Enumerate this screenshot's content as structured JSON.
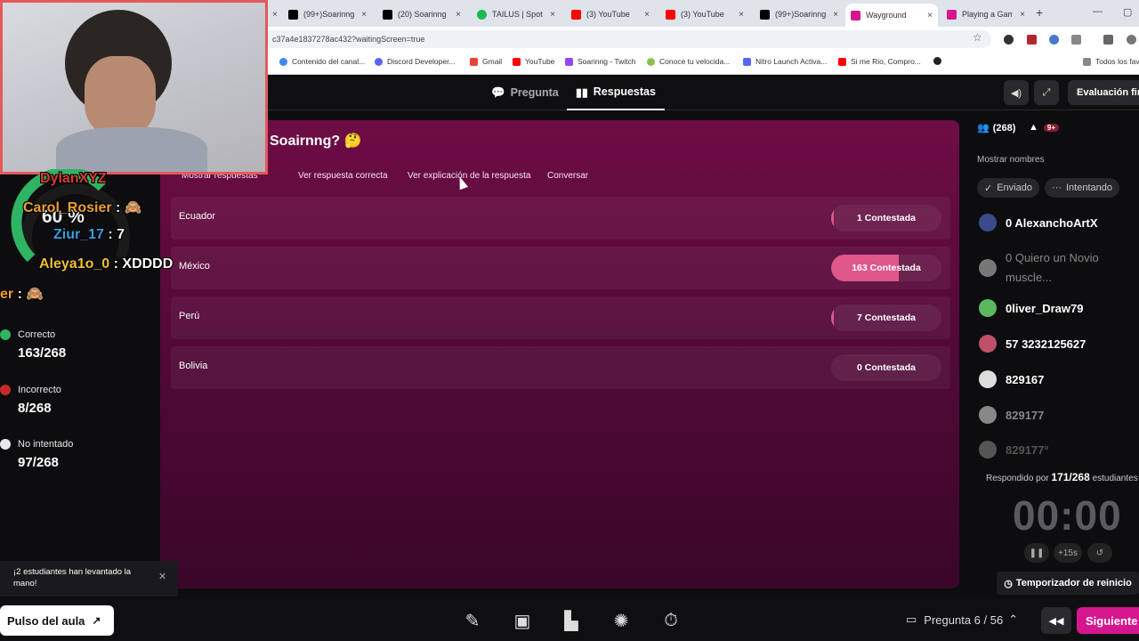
{
  "browser": {
    "tabs": [
      {
        "label": "(99+)Soarinng",
        "color": "#000000"
      },
      {
        "label": "(20) Soarinng",
        "color": "#000000"
      },
      {
        "label": "TAILUS | Spotify",
        "color": "#1db954"
      },
      {
        "label": "(3) YouTube",
        "color": "#ff0000"
      },
      {
        "label": "(3) YouTube",
        "color": "#ff0000"
      },
      {
        "label": "(99+)Soarinng",
        "color": "#000000"
      },
      {
        "label": "Wayground",
        "color": "#d6168e",
        "active": true
      },
      {
        "label": "Playing a Game",
        "color": "#d6168e"
      }
    ],
    "url": "c37a4e1837278ac432?waitingScreen=true",
    "bookmarks": [
      {
        "label": "Contenido del canal...",
        "color": "#4285f4"
      },
      {
        "label": "Discord Developer...",
        "color": "#5865f2"
      },
      {
        "label": "Gmail",
        "color": "#ea4335"
      },
      {
        "label": "YouTube",
        "color": "#ff0000"
      },
      {
        "label": "Soarinng - Twitch",
        "color": "#9146ff"
      },
      {
        "label": "Conoce tu velocida...",
        "color": "#8bc34a"
      },
      {
        "label": "Nitro Launch Activa...",
        "color": "#5865f2"
      },
      {
        "label": "Si me Rio, Compro...",
        "color": "#ff0000"
      },
      {
        "label": "Todos los fav",
        "color": "#888888"
      }
    ]
  },
  "header": {
    "tab_question": "Pregunta",
    "tab_answers": "Respuestas",
    "eval_button": "Evaluación final"
  },
  "question": {
    "title_visible": "Soairnng? 🤔",
    "actions": [
      "Mostrar respuestas",
      "Ver respuesta correcta",
      "Ver explicación de la respuesta",
      "Conversar"
    ],
    "options": [
      {
        "label": "Ecuador",
        "count_text": "1 Contestada",
        "fraction": 0.004
      },
      {
        "label": "México",
        "count_text": "163 Contestada",
        "fraction": 0.61
      },
      {
        "label": "Perú",
        "count_text": "7 Contestada",
        "fraction": 0.026
      },
      {
        "label": "Bolivia",
        "count_text": "0 Contestada",
        "fraction": 0.0
      }
    ]
  },
  "stats": {
    "correct_label": "Correcto",
    "correct_value": "163/268",
    "incorrect_label": "Incorrecto",
    "incorrect_value": "8/268",
    "not_attempted_label": "No intentado",
    "not_attempted_value": "97/268",
    "accuracy_percent": "60 %"
  },
  "toast": {
    "text": "¡2 estudiantes han levantado la mano!"
  },
  "overlay_chat": [
    {
      "user": "DylanXYZ",
      "message": ""
    },
    {
      "user": "Carol_Rosier",
      "message": ": 🙈"
    },
    {
      "user": "Ziur_17",
      "message": ": 7"
    },
    {
      "user": "Aleya1o_0",
      "message": ": XDDDD"
    },
    {
      "user": "er",
      "message": ": 🙈"
    }
  ],
  "right_panel": {
    "participants": "(268)",
    "alerts": "9+",
    "show_names": "Mostrar nombres",
    "filter_sent": "Enviado",
    "filter_trying": "Intentando",
    "students": [
      {
        "name": "0 AlexanchoArtX",
        "color": "#3a4a8a",
        "dim": false
      },
      {
        "name": "0 Quiero un Novio muscle...",
        "color": "#777777",
        "dim": true
      },
      {
        "name": "0liver_Draw79",
        "color": "#5cb85c",
        "dim": false
      },
      {
        "name": "57 3232125627",
        "color": "#c0506a",
        "dim": false
      },
      {
        "name": "829167",
        "color": "#dddddd",
        "dim": false
      },
      {
        "name": "829177",
        "color": "#888888",
        "dim": true
      },
      {
        "name": "829177°",
        "color": "#666666",
        "dim": true
      }
    ],
    "answered_prefix": "Respondido por",
    "answered_value": "171/268",
    "answered_suffix": "estudiantes",
    "timer": "00:00",
    "plus15": "+15s",
    "restart_timer": "Temporizador de reinicio"
  },
  "bottom": {
    "pulse_button": "Pulso del aula",
    "question_counter": "Pregunta 6 / 56",
    "next_button": "Siguiente"
  }
}
